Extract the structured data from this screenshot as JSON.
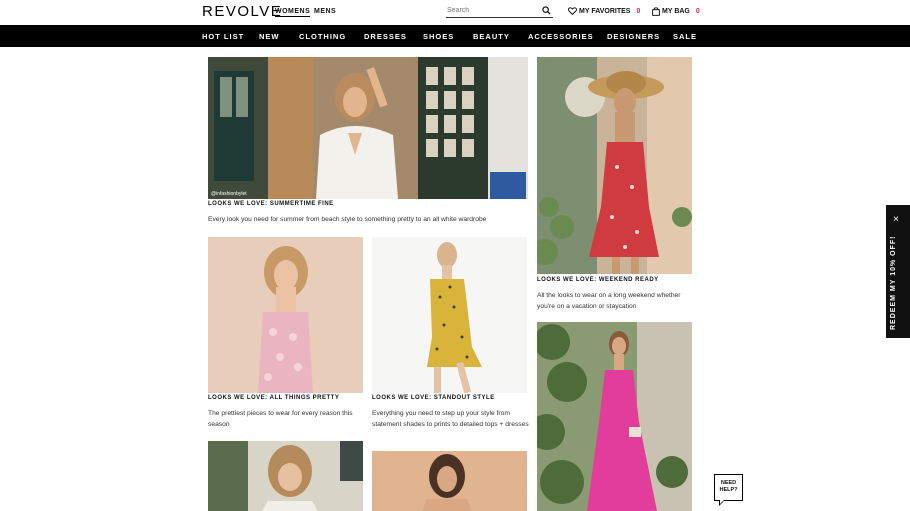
{
  "header": {
    "logo": "REVOLVE",
    "nav_gender": [
      "WOMENS",
      "MENS"
    ],
    "search_placeholder": "Search",
    "favorites_label": "MY FAVORITES",
    "favorites_count": "0",
    "bag_label": "MY BAG",
    "bag_count": "0"
  },
  "nav": {
    "items": [
      "HOT LIST",
      "NEW",
      "CLOTHING",
      "DRESSES",
      "SHOES",
      "BEAUTY",
      "ACCESSORIES",
      "DESIGNERS",
      "SALE"
    ]
  },
  "tiles": [
    {
      "title": "LOOKS WE LOVE: SUMMERTIME FINE",
      "desc": "Every look you need for summer from beach style to something pretty to an all white wardrobe",
      "watermark": "@infashionbylet"
    },
    {
      "title": "LOOKS WE LOVE: WEEKEND READY",
      "desc": "All the looks to wear on a long weekend whether you're on a vacation or staycation"
    },
    {
      "title": "LOOKS WE LOVE: ALL THINGS PRETTY",
      "desc": "The prettiest pieces to wear for every reason this season"
    },
    {
      "title": "LOOKS WE LOVE: STANDOUT STYLE",
      "desc": "Everything you need to step up your style from statement shades to prints to detailed tops + dresses"
    }
  ],
  "promo": {
    "label": "REDEEM MY 10% OFF!",
    "close": "×"
  },
  "help": {
    "label": "NEED HELP?"
  },
  "colors": {
    "accent": "#e0245e",
    "navbar": "#000000"
  }
}
